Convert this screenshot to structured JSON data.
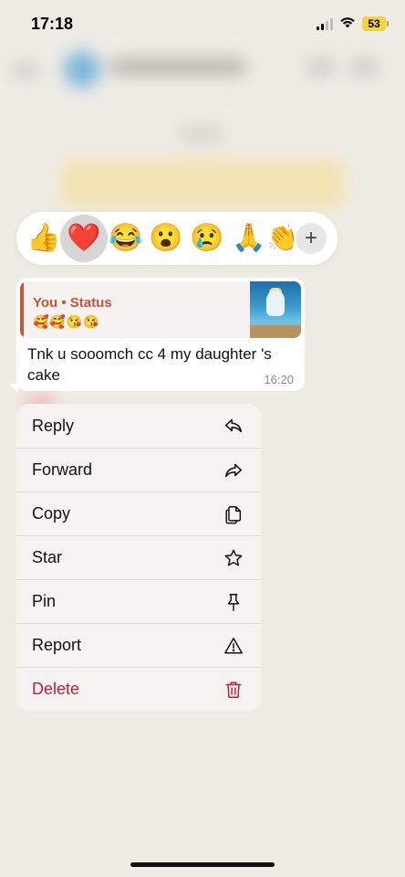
{
  "status_bar": {
    "time": "17:18",
    "battery": "53",
    "battery_color": "#f5d33b"
  },
  "reactions": [
    {
      "icon": "thumbs-up",
      "glyph": "👍",
      "selected": false
    },
    {
      "icon": "red-heart",
      "glyph": "❤️",
      "selected": true
    },
    {
      "icon": "tears-of-joy",
      "glyph": "😂",
      "selected": false
    },
    {
      "icon": "surprised-face",
      "glyph": "😮",
      "selected": false
    },
    {
      "icon": "crying-face",
      "glyph": "😢",
      "selected": false
    },
    {
      "icon": "folded-hands",
      "glyph": "🙏",
      "selected": false
    },
    {
      "icon": "clapping-hands",
      "glyph": "👏",
      "selected": false
    }
  ],
  "reaction_more": "+",
  "message": {
    "quote_author": "You • Status",
    "quote_emojis": "🥰🥰😘😘",
    "text": "Tnk u sooomch cc 4 my daughter 's cake",
    "time": "16:20",
    "quote_accent_color": "#c8553d"
  },
  "menu": [
    {
      "label": "Reply",
      "icon": "reply-icon"
    },
    {
      "label": "Forward",
      "icon": "forward-icon"
    },
    {
      "label": "Copy",
      "icon": "copy-icon"
    },
    {
      "label": "Star",
      "icon": "star-icon"
    },
    {
      "label": "Pin",
      "icon": "pin-icon"
    },
    {
      "label": "Report",
      "icon": "warning-icon"
    },
    {
      "label": "Delete",
      "icon": "trash-icon",
      "danger": true,
      "color": "#c41c3b"
    }
  ]
}
